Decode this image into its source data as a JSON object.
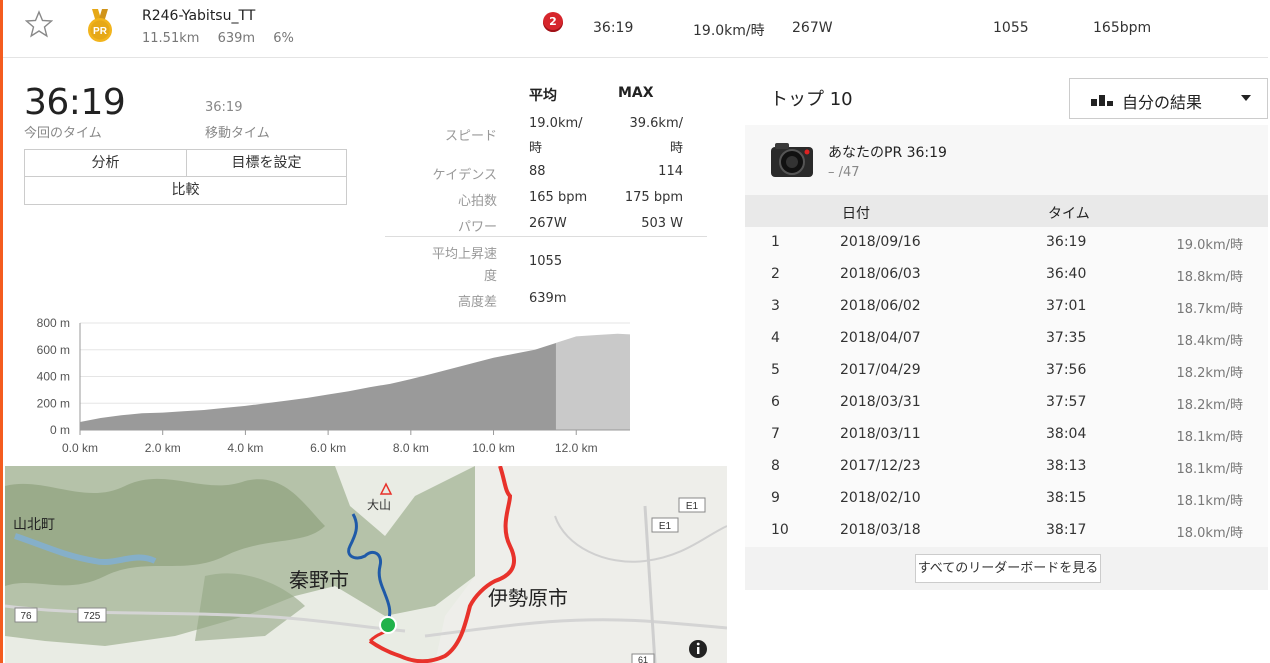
{
  "segment": {
    "name": "R246-Yabitsu_TT",
    "distance": "11.51km",
    "elevation": "639m",
    "grade": "6%",
    "rank_badge": "2",
    "time": "36:19",
    "speed": "19.0km/時",
    "power": "267W",
    "vam": "1055",
    "heart_rate": "165bpm",
    "medal_label": "PR"
  },
  "summary": {
    "elapsed_time": "36:19",
    "elapsed_label": "今回のタイム",
    "moving_time": "36:19",
    "moving_label": "移動タイム",
    "buttons": {
      "analysis": "分析",
      "set_goal": "目標を設定",
      "compare": "比較"
    }
  },
  "stats": {
    "headers": {
      "avg": "平均",
      "max": "MAX"
    },
    "rows": {
      "speed": {
        "label": "スピード",
        "avg_1": "19.0km/",
        "avg_2": "時",
        "max_1": "39.6km/",
        "max_2": "時"
      },
      "cadence": {
        "label": "ケイデンス",
        "avg": "88",
        "max": "114"
      },
      "heart_rate": {
        "label": "心拍数",
        "avg": "165 bpm",
        "max": "175 bpm"
      },
      "power": {
        "label": "パワー",
        "avg": "267W",
        "max": "503 W"
      },
      "vam": {
        "label_1": "平均上昇速",
        "label_2": "度",
        "value": "1055"
      },
      "elev_gain": {
        "label": "高度差",
        "value": "639m"
      }
    }
  },
  "chart_data": {
    "type": "area",
    "title": "",
    "xlabel": "",
    "ylabel": "",
    "x_ticks": [
      "0.0 km",
      "2.0 km",
      "4.0 km",
      "6.0 km",
      "8.0 km",
      "10.0 km",
      "12.0 km"
    ],
    "y_ticks": [
      "0 m",
      "200 m",
      "400 m",
      "600 m",
      "800 m"
    ],
    "xlim": [
      0,
      13.3
    ],
    "ylim": [
      0,
      800
    ],
    "segment_end_km": 11.51,
    "x": [
      0,
      0.5,
      1,
      1.5,
      2,
      2.5,
      3,
      3.5,
      4,
      4.5,
      5,
      5.5,
      6,
      6.5,
      7,
      7.5,
      8,
      8.5,
      9,
      9.5,
      10,
      10.5,
      11,
      11.5,
      12,
      12.5,
      13,
      13.3
    ],
    "y": [
      60,
      90,
      110,
      125,
      130,
      140,
      150,
      165,
      180,
      200,
      220,
      240,
      265,
      290,
      320,
      345,
      380,
      420,
      460,
      500,
      540,
      570,
      600,
      650,
      700,
      710,
      720,
      715
    ],
    "fill_color": "#9a9a9a",
    "fill_color_after": "#c9c9c9"
  },
  "map": {
    "labels": {
      "yamakita": "山北町",
      "hadano": "秦野市",
      "isehara": "伊勢原市",
      "oyama": "大山",
      "road_76": "76",
      "road_725": "725",
      "road_e1a": "E1",
      "road_e1b": "E1",
      "road_61": "61"
    },
    "colors": {
      "route": "#e8322b",
      "segment": "#1f5aa8",
      "start": "#20b24a"
    }
  },
  "top10": {
    "title": "トップ 10",
    "dropdown": "自分の結果",
    "pr_title": "あなたのPR 36:19",
    "pr_sub": "– /47",
    "columns": {
      "date": "日付",
      "time": "タイム"
    },
    "rows": [
      {
        "rank": "1",
        "date": "2018/09/16",
        "time": "36:19",
        "speed": "19.0km/時"
      },
      {
        "rank": "2",
        "date": "2018/06/03",
        "time": "36:40",
        "speed": "18.8km/時"
      },
      {
        "rank": "3",
        "date": "2018/06/02",
        "time": "37:01",
        "speed": "18.7km/時"
      },
      {
        "rank": "4",
        "date": "2018/04/07",
        "time": "37:35",
        "speed": "18.4km/時"
      },
      {
        "rank": "5",
        "date": "2017/04/29",
        "time": "37:56",
        "speed": "18.2km/時"
      },
      {
        "rank": "6",
        "date": "2018/03/31",
        "time": "37:57",
        "speed": "18.2km/時"
      },
      {
        "rank": "7",
        "date": "2018/03/11",
        "time": "38:04",
        "speed": "18.1km/時"
      },
      {
        "rank": "8",
        "date": "2017/12/23",
        "time": "38:13",
        "speed": "18.1km/時"
      },
      {
        "rank": "9",
        "date": "2018/02/10",
        "time": "38:15",
        "speed": "18.1km/時"
      },
      {
        "rank": "10",
        "date": "2018/03/18",
        "time": "38:17",
        "speed": "18.0km/時"
      }
    ],
    "view_all": "すべてのリーダーボードを見る"
  },
  "colors": {
    "accent": "#f45c1f",
    "rank_badge": "#d6262c",
    "medal": "#e6a817"
  }
}
